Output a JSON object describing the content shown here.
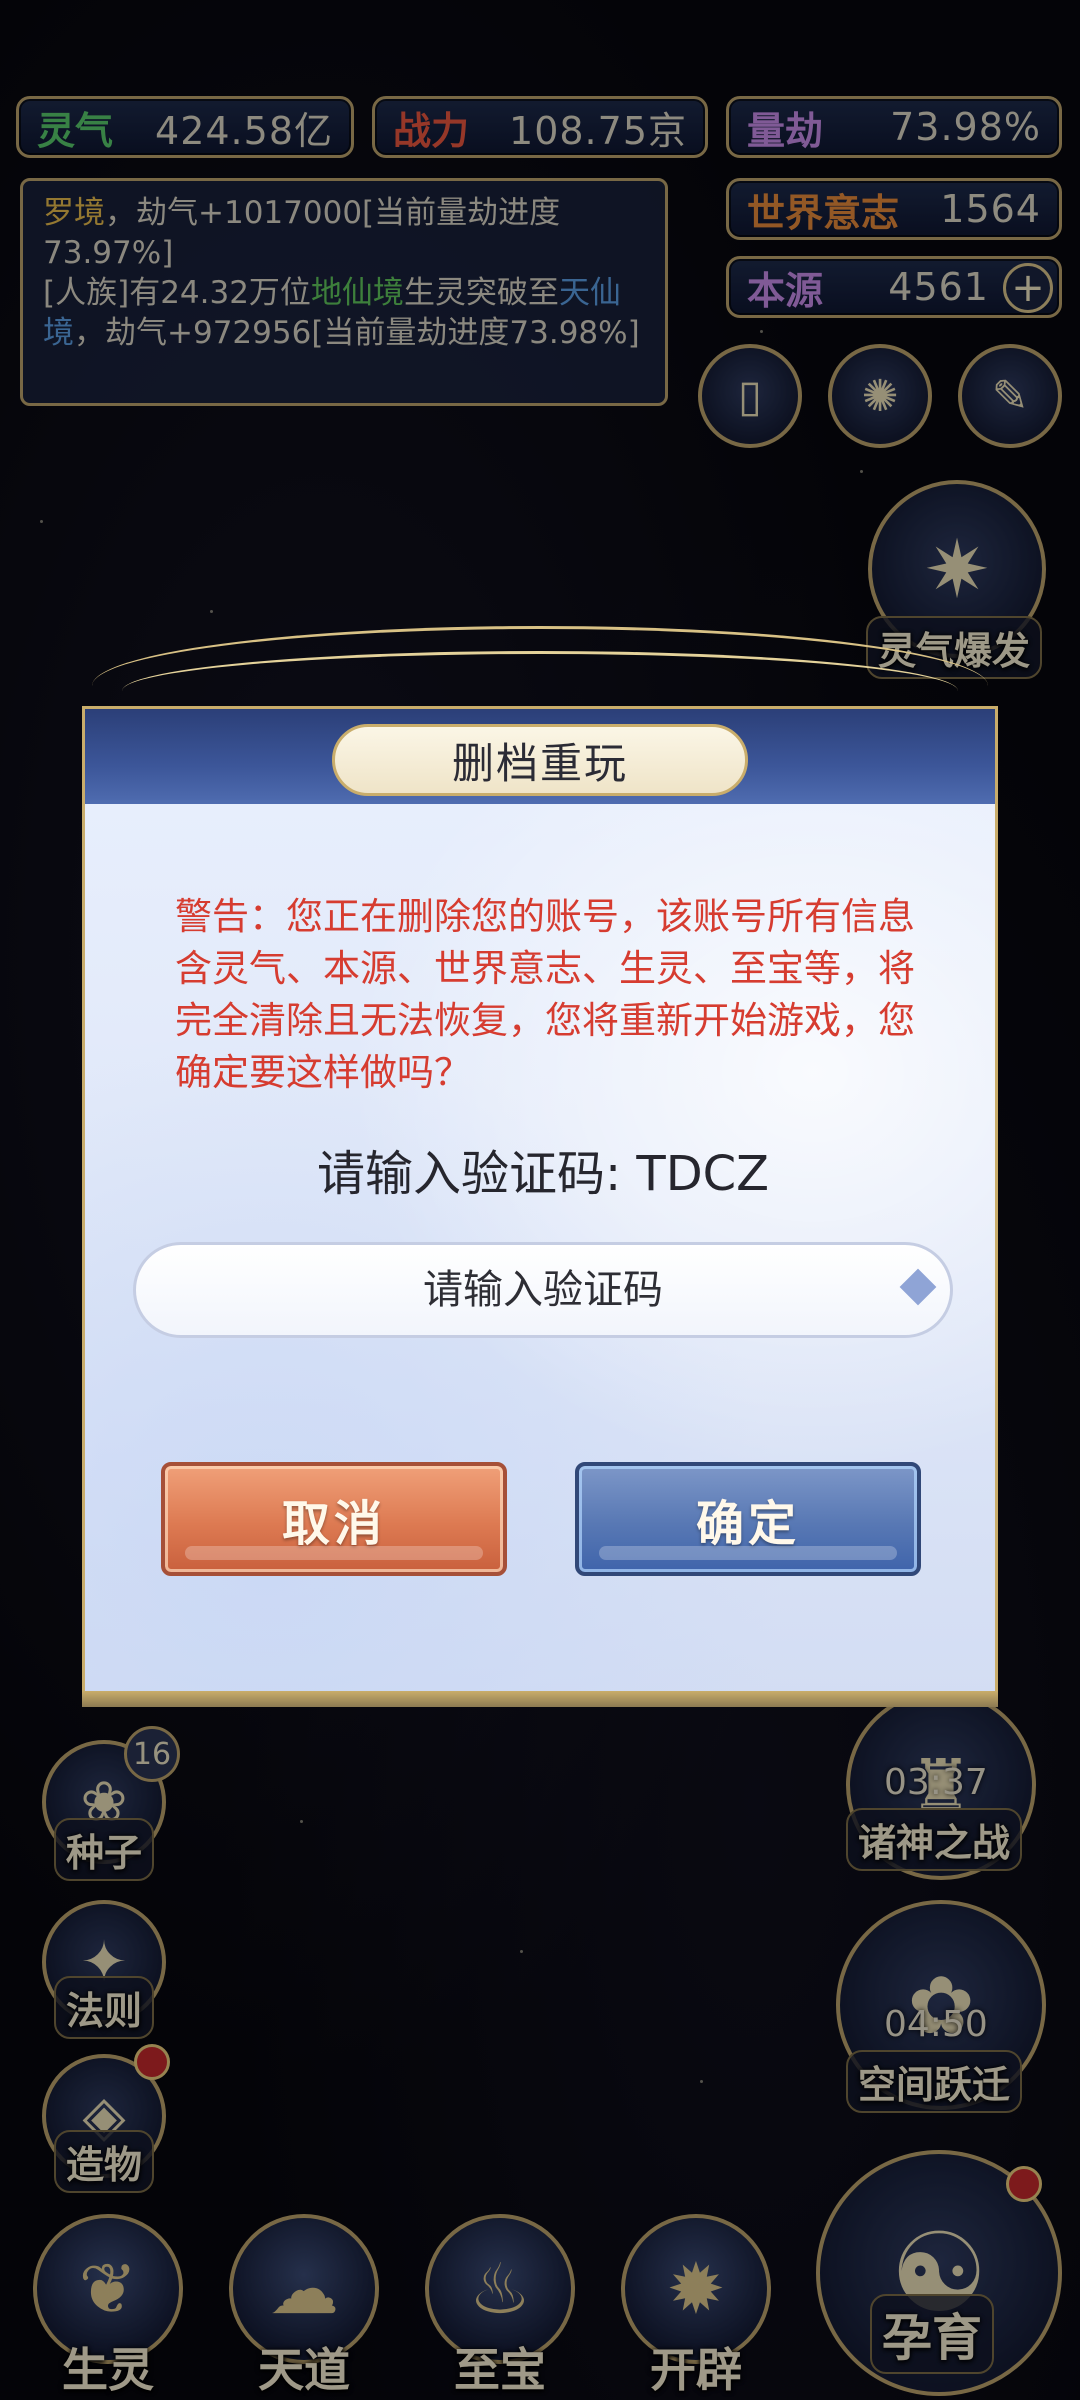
{
  "stats": {
    "lingqi": {
      "label": "灵气",
      "value": "424.58亿"
    },
    "zhanli": {
      "label": "战力",
      "value": "108.75京"
    },
    "liangjie": {
      "label": "量劫",
      "value": "73.98%"
    },
    "shijieyizhi": {
      "label": "世界意志",
      "value": "1564"
    },
    "benyuan": {
      "label": "本源",
      "value": "4561"
    },
    "plus_icon": "plus-icon"
  },
  "log": {
    "line1": {
      "place": "罗境",
      "text": "，劫气+1017000[当前量劫进度73.97%]"
    },
    "line2": {
      "prefix": "[人族]有24.32万位",
      "realm_from": "地仙境",
      "mid": "生灵突破至",
      "realm_to": "天仙境",
      "suffix": "，劫气+972956[当前量劫进度73.98%]"
    }
  },
  "right_menu": {
    "lingqi_baofa": "灵气爆发",
    "zhushen_zhizhan": {
      "label": "诸神之战",
      "timer": "03:37"
    },
    "kongjian_yueqian": {
      "label": "空间跃迁",
      "timer": "04:50"
    },
    "yunyu": "孕育"
  },
  "left_menu": {
    "zhongzi": {
      "label": "种子",
      "count": "16"
    },
    "faze": "法则",
    "zaowu": "造物"
  },
  "bottom_tabs": [
    "生灵",
    "天道",
    "至宝",
    "开辟"
  ],
  "dialog": {
    "title": "删档重玩",
    "warning": "警告：您正在删除您的账号，该账号所有信息含灵气、本源、世界意志、生灵、至宝等，将完全清除且无法恢复，您将重新开始游戏，您确定要这样做吗？",
    "code_prompt": "请输入验证码: TDCZ",
    "input_placeholder": "请输入验证码",
    "input_value": "",
    "cancel": "取消",
    "confirm": "确定"
  },
  "colors": {
    "warning_text": "#d63c30",
    "cancel_button": "#dd7a52",
    "confirm_button": "#5878b4",
    "frame_gold": "#b9a06a"
  }
}
